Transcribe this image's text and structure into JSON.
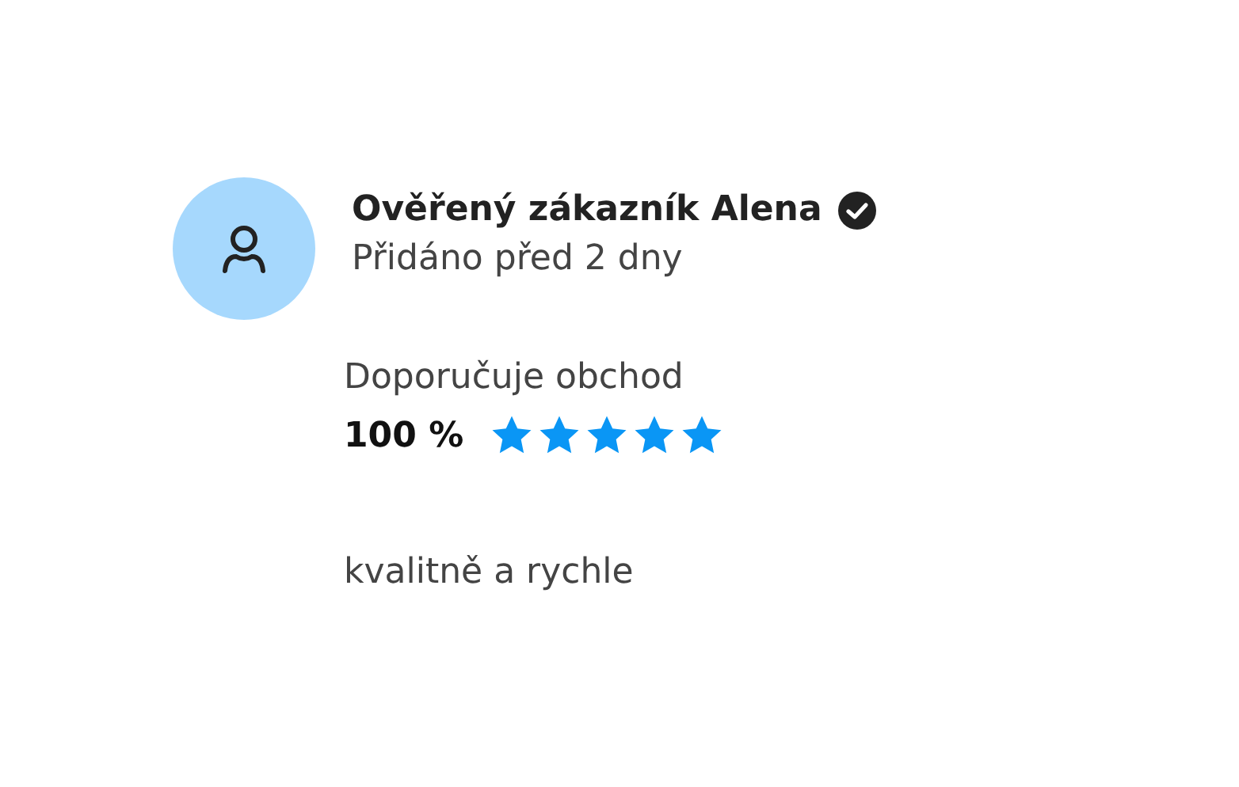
{
  "review": {
    "author": "Ověřený zákazník Alena",
    "verified": true,
    "added": "Přidáno před 2 dny",
    "recommend_label": "Doporučuje obchod",
    "percent": "100 %",
    "stars": 5,
    "text": "kvalitně a rychle"
  }
}
